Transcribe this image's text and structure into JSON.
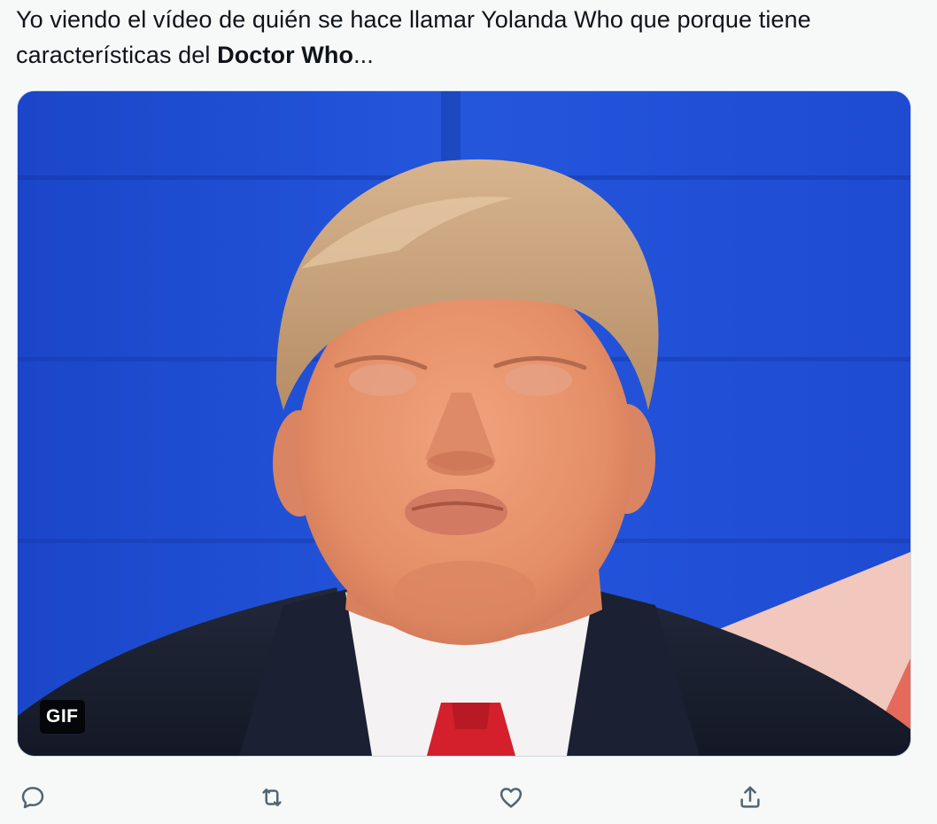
{
  "tweet": {
    "text_part1": "Yo viendo el vídeo de quién se hace llamar Yolanda Who que porque tiene características del ",
    "text_bold": "Doctor Who",
    "text_part2": "..."
  },
  "media": {
    "badge": "GIF",
    "background_color": "#1f4fd6"
  },
  "actions": [
    {
      "icon": "reply-icon"
    },
    {
      "icon": "retweet-icon"
    },
    {
      "icon": "like-icon"
    },
    {
      "icon": "share-icon"
    }
  ],
  "colors": {
    "text": "#0f1419",
    "icon": "#536471",
    "page_background": "#f7f9f9"
  }
}
